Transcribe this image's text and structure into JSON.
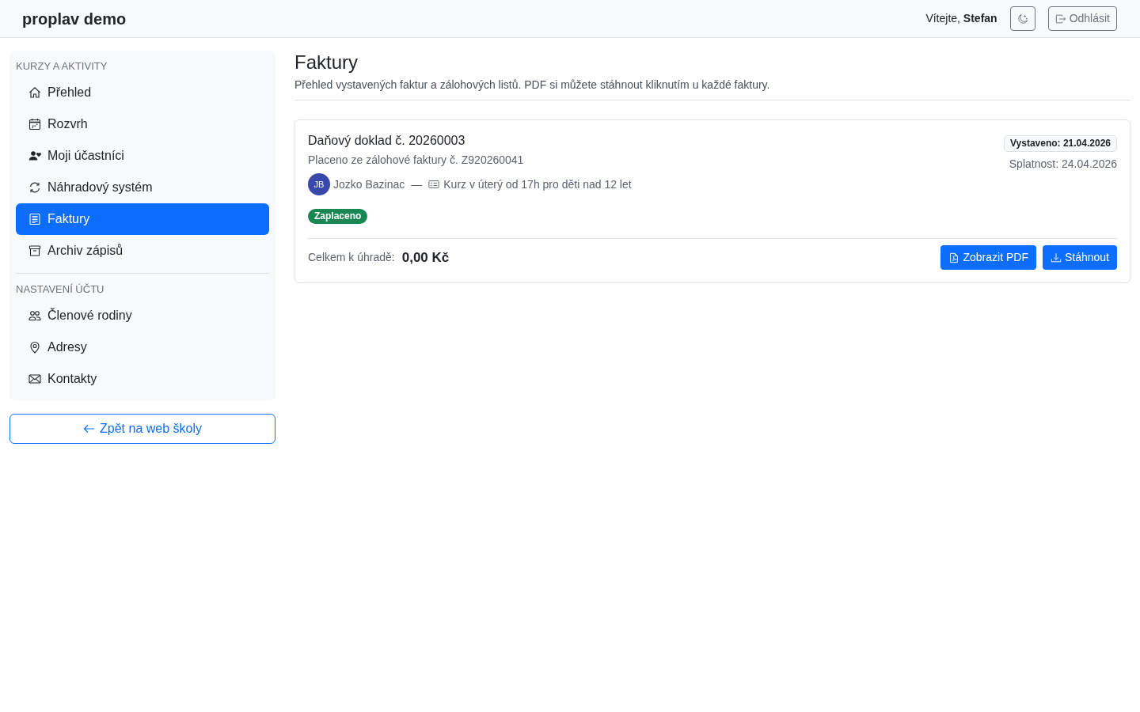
{
  "header": {
    "brand": "proplav demo",
    "greeting": "Vítejte, **Stefan**",
    "logout_label": "Odhlásit"
  },
  "sidebar": {
    "sections": [
      {
        "title": "KURZY A AKTIVITY",
        "items": [
          {
            "label": "Přehled",
            "selected": false
          },
          {
            "label": "Rozvrh",
            "selected": false
          },
          {
            "label": "Moji účastníci",
            "selected": false
          },
          {
            "label": "Náhradový systém",
            "selected": false
          },
          {
            "label": "Faktury",
            "selected": true
          },
          {
            "label": "Archiv zápisů",
            "selected": false
          }
        ]
      },
      {
        "title": "NASTAVENÍ ÚČTU",
        "items": [
          {
            "label": "Členové rodiny",
            "selected": false
          },
          {
            "label": "Adresy",
            "selected": false
          },
          {
            "label": "Kontakty",
            "selected": false
          }
        ]
      }
    ],
    "back_link": "Zpět na web školy"
  },
  "page": {
    "title": "Faktury",
    "description": "Přehled vystavených faktur a zálohových listů. PDF si můžete stáhnout kliknutím u každé faktury."
  },
  "invoices": [
    {
      "title": "Daňový doklad č. 20260003",
      "subtitle": "Placeno ze zálohové faktury č. Z920260041",
      "participant": {
        "initials": "JB",
        "name": "Jozko Bazinac"
      },
      "separator": "—",
      "course": "Kurz v úterý od 17h pro děti nad 12 let",
      "status": "Zaplaceno",
      "issued": "Vystaveno: 21.04.2026",
      "due": "Splatnost: 24.04.2026",
      "total_label": "Celkem k úhradě:",
      "total": "0,00 Kč",
      "actions": [
        "Zobrazit PDF",
        "Stáhnout"
      ]
    }
  ]
}
